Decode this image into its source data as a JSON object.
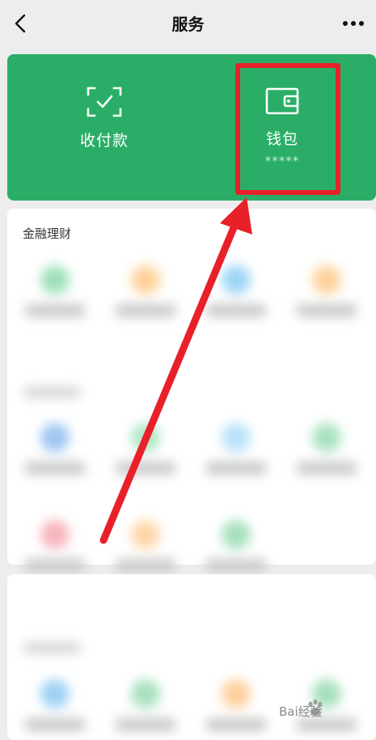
{
  "header": {
    "title": "服务"
  },
  "card": {
    "pay_label": "收付款",
    "wallet_label": "钱包",
    "wallet_balance": "*****",
    "background": "#2aae67"
  },
  "sections": [
    {
      "title": "金融理财"
    }
  ],
  "watermark": {
    "text": "Bai经验"
  },
  "annotation": {
    "color": "#e8202a"
  }
}
